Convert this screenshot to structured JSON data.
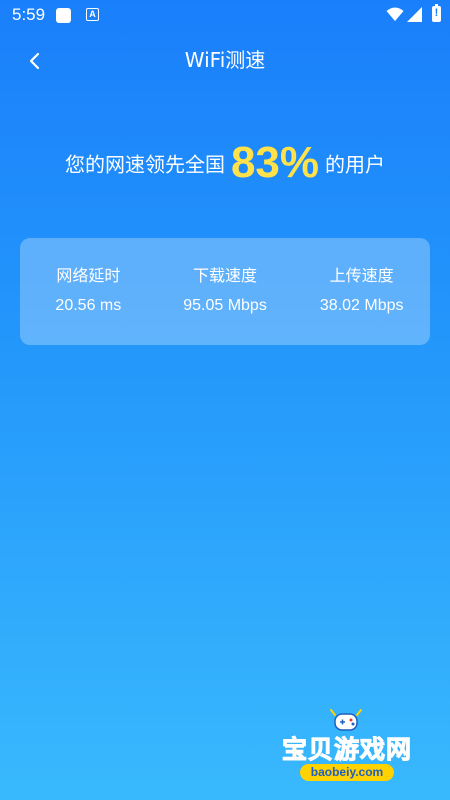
{
  "status_bar": {
    "time": "5:59",
    "a_icon_label": "A",
    "icons": [
      "app-icon",
      "a-icon",
      "wifi-icon",
      "signal-icon",
      "battery-icon"
    ]
  },
  "nav": {
    "back_icon": "chevron-left-icon",
    "title": "WiFi测速"
  },
  "hero": {
    "prefix": "您的网速领先全国",
    "percent": "83%",
    "suffix": "的用户",
    "percent_color": "#ffe24a"
  },
  "stats": [
    {
      "label": "网络延时",
      "value": "20.56 ms"
    },
    {
      "label": "下载速度",
      "value": "95.05 Mbps"
    },
    {
      "label": "上传速度",
      "value": "38.02 Mbps"
    }
  ],
  "watermark": {
    "title": "宝贝游戏网",
    "url": "baobeiy.com"
  },
  "colors": {
    "background_top": "#1a7ffb",
    "background_bottom": "#39b9fd",
    "watermark_yellow": "#ffd200"
  }
}
